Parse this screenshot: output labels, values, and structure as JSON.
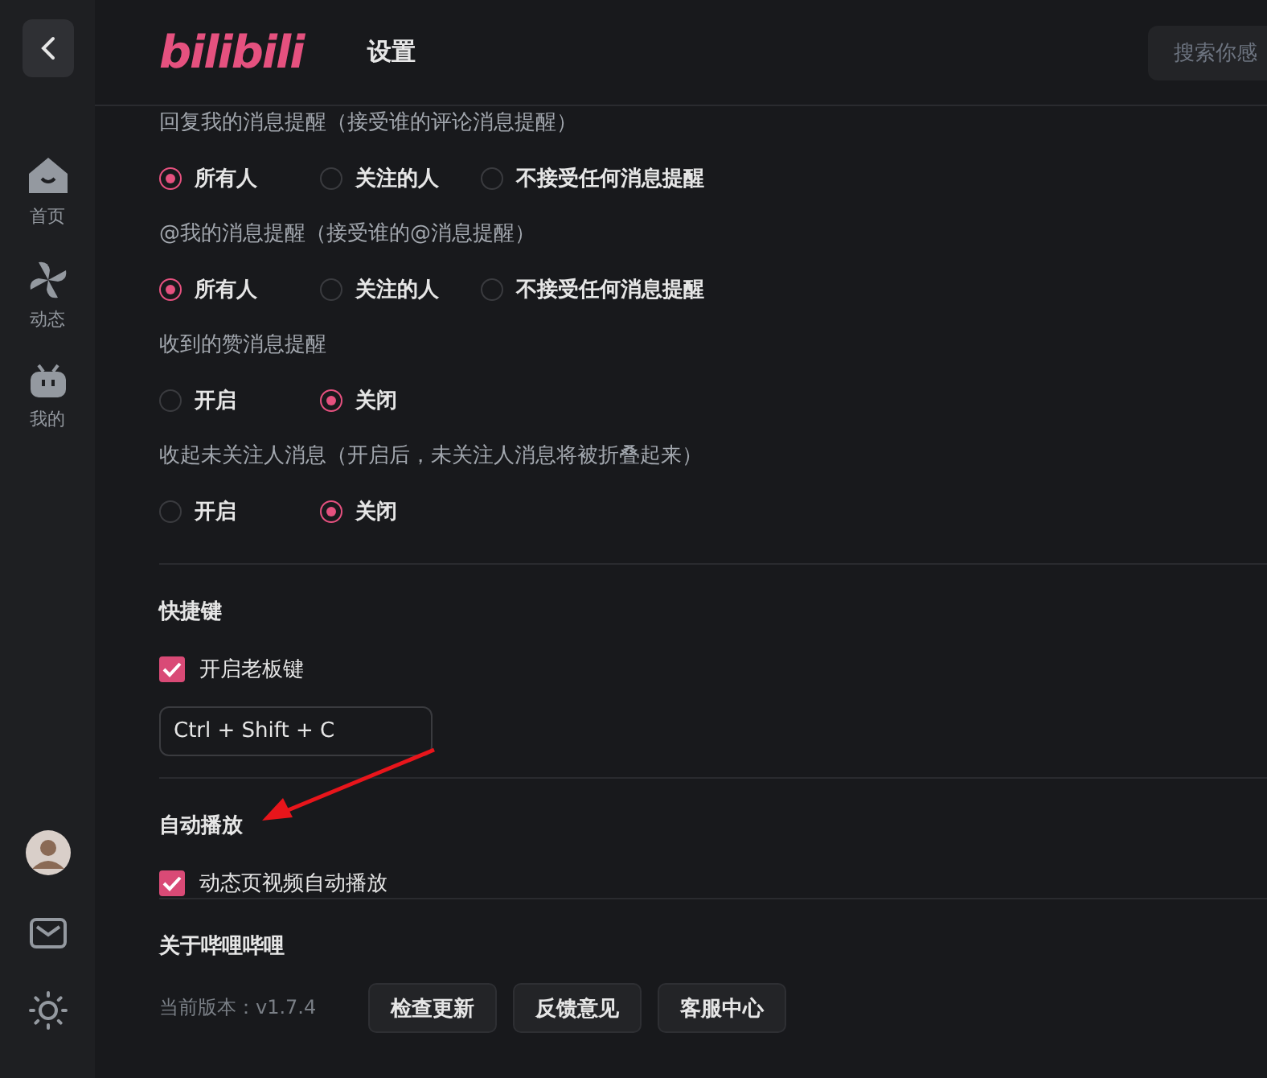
{
  "header": {
    "logo": "bilibili",
    "title": "设置",
    "search": {
      "placeholder": "搜索你感"
    }
  },
  "sidebar": {
    "items": [
      {
        "kind": "home",
        "label": "首页"
      },
      {
        "kind": "dynamic",
        "label": "动态"
      },
      {
        "kind": "mine",
        "label": "我的"
      }
    ],
    "bottom": [
      {
        "kind": "avatar"
      },
      {
        "kind": "mail"
      },
      {
        "kind": "theme"
      }
    ]
  },
  "notification_groups": [
    {
      "label": "回复我的消息提醒（接受谁的评论消息提醒）",
      "options": [
        {
          "label": "所有人",
          "selected": true
        },
        {
          "label": "关注的人",
          "selected": false
        },
        {
          "label": "不接受任何消息提醒",
          "selected": false
        }
      ]
    },
    {
      "label": "@我的消息提醒（接受谁的@消息提醒）",
      "options": [
        {
          "label": "所有人",
          "selected": true
        },
        {
          "label": "关注的人",
          "selected": false
        },
        {
          "label": "不接受任何消息提醒",
          "selected": false
        }
      ]
    },
    {
      "label": "收到的赞消息提醒",
      "options": [
        {
          "label": "开启",
          "selected": false
        },
        {
          "label": "关闭",
          "selected": true
        }
      ]
    },
    {
      "label": "收起未关注人消息（开启后，未关注人消息将被折叠起来）",
      "options": [
        {
          "label": "开启",
          "selected": false
        },
        {
          "label": "关闭",
          "selected": true
        }
      ]
    }
  ],
  "shortcuts": {
    "title": "快捷键",
    "checkbox": {
      "label": "开启老板键",
      "checked": true
    },
    "value": "Ctrl + Shift + C"
  },
  "autoplay": {
    "title": "自动播放",
    "checkbox": {
      "label": "动态页视频自动播放",
      "checked": true
    }
  },
  "about": {
    "title": "关于哔哩哔哩",
    "version": "当前版本：v1.7.4",
    "buttons": [
      "检查更新",
      "反馈意见",
      "客服中心"
    ]
  }
}
